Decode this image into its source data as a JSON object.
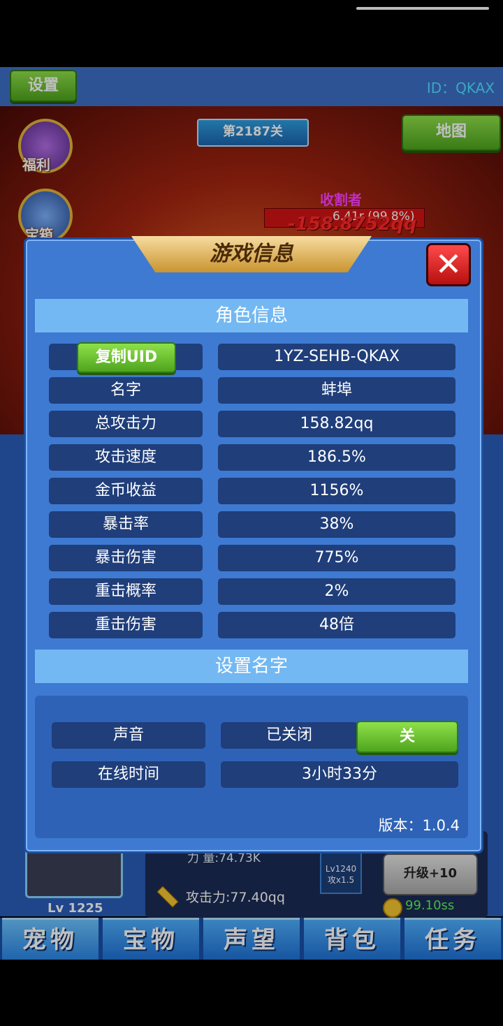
{
  "topbar": {
    "settings_label": "设置",
    "id_text": "ID：QKAX"
  },
  "scene": {
    "stage": "第2187关",
    "map_label": "地图",
    "side_icons": [
      "福利",
      "宝箱"
    ],
    "enemy_name": "收割者",
    "enemy_hp": "6.41r (99.8%)",
    "damage": "-158.8752qq"
  },
  "pet_panel": {
    "level": "Lv 1225",
    "power": "力  量:74.73K",
    "attack": "攻击力:77.40qq",
    "badge_line1": "Lv1240",
    "badge_line2": "攻x1.5",
    "upgrade_label": "升级+10",
    "cost": "99.10ss"
  },
  "bottom_nav": [
    "宠物",
    "宝物",
    "声望",
    "背包",
    "任务"
  ],
  "modal": {
    "title": "游戏信息",
    "section_role": "角色信息",
    "copy_uid_label": "复制UID",
    "uid_value": "1YZ-SEHB-QKAX",
    "rows": [
      {
        "label": "名字",
        "value": "蚌埠"
      },
      {
        "label": "总攻击力",
        "value": "158.82qq"
      },
      {
        "label": "攻击速度",
        "value": "186.5%"
      },
      {
        "label": "金币收益",
        "value": "1156%"
      },
      {
        "label": "暴击率",
        "value": "38%"
      },
      {
        "label": "暴击伤害",
        "value": "775%"
      },
      {
        "label": "重击概率",
        "value": "2%"
      },
      {
        "label": "重击伤害",
        "value": "48倍"
      }
    ],
    "section_name": "设置名字",
    "sound_label": "声音",
    "sound_status": "已关闭",
    "sound_toggle": "关",
    "online_label": "在线时间",
    "online_value": "3小时33分",
    "version": "版本：1.0.4"
  }
}
